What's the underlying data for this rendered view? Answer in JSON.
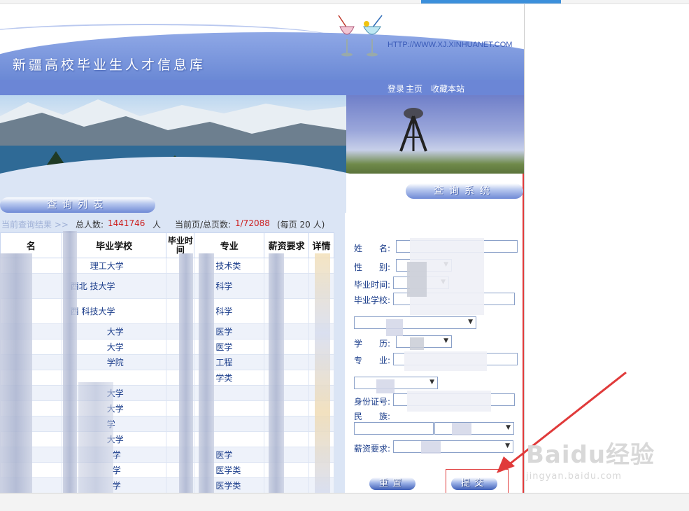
{
  "header": {
    "site_title": "新疆高校毕业生人才信息库",
    "site_url": "HTTP://WWW.XJ.XINHUANET.COM"
  },
  "nav": {
    "login": "登录",
    "home": "主页",
    "bookmark": "收藏本站"
  },
  "list": {
    "section_title": "查询列表",
    "stats": {
      "prefix": "当前查询结果 >>",
      "total_label": "总人数:",
      "total_value": "1441746",
      "total_unit": "人",
      "page_label": "当前页/总页数:",
      "page_value": "1/72088",
      "per_page": "(每页 20 人)"
    },
    "columns": [
      "名",
      "毕业学校",
      "毕业时间",
      "专业",
      "薪资要求",
      "详情"
    ],
    "rows": [
      {
        "school": "理工大学",
        "major": "技术类"
      },
      {
        "school": "西北    技大学",
        "major": "科学"
      },
      {
        "school": "西      科技大学",
        "major": "科学"
      },
      {
        "school": "大学",
        "major": "医学"
      },
      {
        "school": "大学",
        "major": "医学"
      },
      {
        "school": "学院",
        "major": "工程"
      },
      {
        "school": "",
        "major": "学类"
      },
      {
        "school": "大学",
        "major": ""
      },
      {
        "school": "大学",
        "major": ""
      },
      {
        "school": "学",
        "major": ""
      },
      {
        "school": "大学",
        "major": ""
      },
      {
        "school": "学",
        "major": "医学"
      },
      {
        "school": "学",
        "major": "医学类"
      },
      {
        "school": "学",
        "major": "医学类"
      }
    ]
  },
  "search": {
    "section_title": "查询系统",
    "fields": {
      "name": "姓　　名:",
      "gender": "性　　别:",
      "grad_time": "毕业时间:",
      "school": "毕业学校:",
      "education": "学　　历:",
      "major": "专　　业:",
      "id_number": "身份证号:",
      "ethnicity": "民　　族:",
      "salary": "薪资要求:"
    },
    "reset_label": "重置",
    "submit_label": "提交"
  },
  "watermark": {
    "brand": "Baidu经验",
    "url": "jingyan.baidu.com"
  },
  "colors": {
    "accent_blue": "#6b86d6",
    "link_blue": "#1a3c8a",
    "highlight_red": "#e03a3a",
    "stat_red": "#cc1f1f"
  }
}
